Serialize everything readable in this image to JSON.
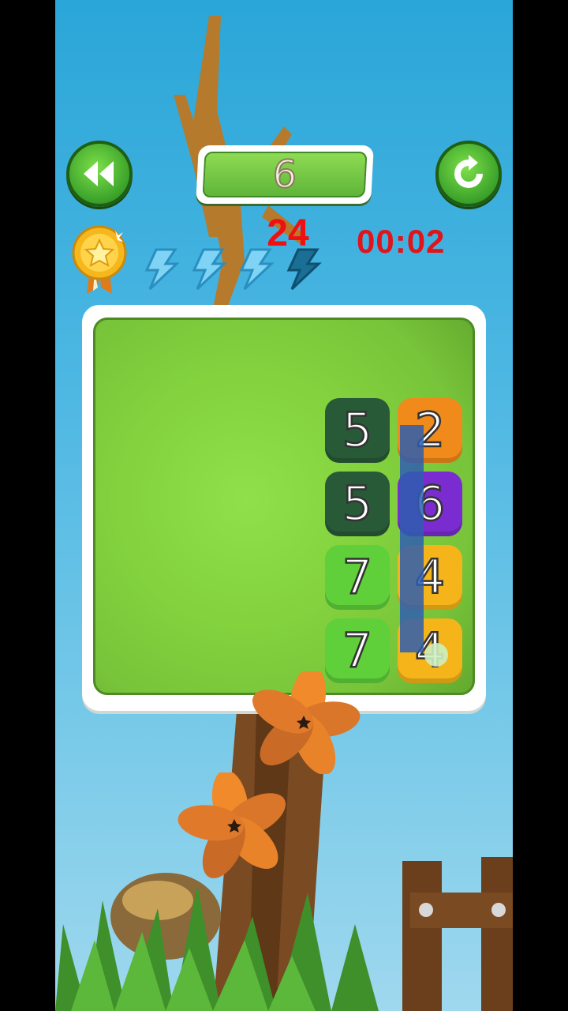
{
  "header": {
    "level": "6",
    "moves": "24",
    "timer": "00:02"
  },
  "energy": {
    "total": 4,
    "filled": 3
  },
  "board": {
    "tiles": [
      {
        "value": "5",
        "color": "#285a37"
      },
      {
        "value": "2",
        "color": "#f08a1a"
      },
      {
        "value": "5",
        "color": "#285a37"
      },
      {
        "value": "6",
        "color": "#7a2cd0"
      },
      {
        "value": "7",
        "color": "#5fcf3a"
      },
      {
        "value": "4",
        "color": "#f4b41a"
      },
      {
        "value": "7",
        "color": "#5fcf3a"
      },
      {
        "value": "4",
        "color": "#f4b41a"
      }
    ]
  },
  "icons": {
    "back": "double-arrow-left-icon",
    "restart": "restart-icon",
    "medal": "star-medal-icon",
    "energy": "lightning-icon"
  }
}
